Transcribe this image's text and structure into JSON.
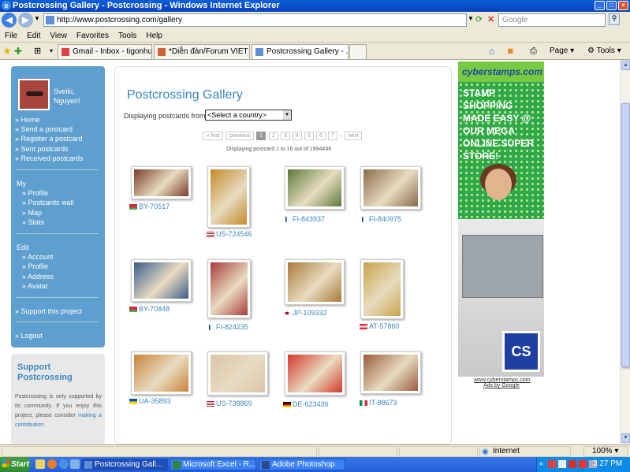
{
  "window": {
    "title": "Postcrossing Gallery - Postcrossing - Windows Internet Explorer"
  },
  "address_bar": {
    "url": "http://www.postcrossing.com/gallery",
    "search_placeholder": "Google"
  },
  "menu": [
    "File",
    "Edit",
    "View",
    "Favorites",
    "Tools",
    "Help"
  ],
  "tabs": [
    {
      "label": "Gmail - Inbox - tigonhueh...",
      "icon": "gmail-icon"
    },
    {
      "label": "*Diễn đàn/Forum VIET S...",
      "icon": "forum-icon"
    },
    {
      "label": "Postcrossing Gallery - ...",
      "icon": "page-icon",
      "active": true
    }
  ],
  "toolbar_right": {
    "page": "Page",
    "tools": "Tools"
  },
  "sidebar": {
    "username": "Sveiki, Nguyen!",
    "main_links": [
      "» Home",
      "» Send a postcard",
      "» Register a postcard",
      "» Sent postcards",
      "» Received postcards"
    ],
    "my_heading": "My",
    "my_links": [
      "» Profile",
      "» Postcards wall",
      "» Map",
      "» Stats"
    ],
    "edit_heading": "Edit",
    "edit_links": [
      "» Account",
      "» Profile",
      "» Address",
      "» Avatar"
    ],
    "support_link": "» Support this project",
    "logout": "» Logout"
  },
  "support_box": {
    "title": "Support Postcrossing",
    "text": "Postcrossing is only supported by its community. If you enjoy this project, please consider ",
    "link": "making a contribution."
  },
  "gallery": {
    "title": "Postcrossing Gallery",
    "displaying_from_label": "Displaying postcards from",
    "country_select": "<Select a country>",
    "pagination": [
      "« first",
      "previous",
      "1",
      "2",
      "3",
      "4",
      "5",
      "6",
      "7",
      "...",
      "next"
    ],
    "count_text": "Displaying postcard 1 to 16 out of 1994436",
    "cards": [
      {
        "id": "BY-70517",
        "flag": "by",
        "color": "#7a3b2a"
      },
      {
        "id": "US-724546",
        "flag": "us",
        "color": "#c48a2a"
      },
      {
        "id": "FI-843937",
        "flag": "fi",
        "color": "#5b7a3a"
      },
      {
        "id": "FI-840975",
        "flag": "fi",
        "color": "#8a6a4a"
      },
      {
        "id": "BY-70848",
        "flag": "by",
        "color": "#3a5c8a"
      },
      {
        "id": "FI-824235",
        "flag": "fi",
        "color": "#a83a3a"
      },
      {
        "id": "JP-109332",
        "flag": "jp",
        "color": "#a87a3a"
      },
      {
        "id": "AT-57860",
        "flag": "at",
        "color": "#c9a34a"
      },
      {
        "id": "UA-35893",
        "flag": "ua",
        "color": "#c8843a"
      },
      {
        "id": "US-738869",
        "flag": "us",
        "color": "#dac4a8"
      },
      {
        "id": "DE-623436",
        "flag": "de",
        "color": "#d4382a"
      },
      {
        "id": "IT-88673",
        "flag": "it",
        "color": "#9a5a3a"
      }
    ]
  },
  "ad": {
    "logo": "cyberstamps.com",
    "headline": "STAMP SHOPPING MADE EASY @ OUR MEGA ONLINE SUPER STORE!",
    "url": "www.cyberstamps.com",
    "ads_by": "Ads by Google"
  },
  "status_bar": {
    "zone": "Internet",
    "zoom": "100%"
  },
  "taskbar": {
    "start": "Start",
    "tasks": [
      {
        "label": "Postcrossing Gall...",
        "active": true
      },
      {
        "label": "Microsoft Excel - R...",
        "active": false
      },
      {
        "label": "Adobe Photoshop",
        "active": false
      }
    ],
    "clock": "3:27 PM"
  },
  "colors": {
    "accent": "#3a86c0",
    "sidebar": "#5f9fcf",
    "ad_green": "#39b54a"
  }
}
